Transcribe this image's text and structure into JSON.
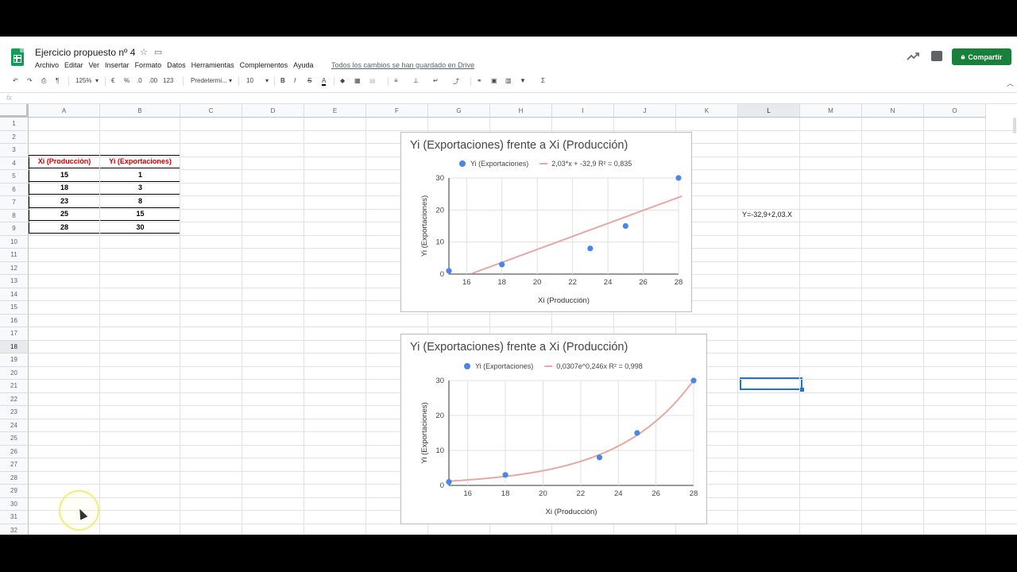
{
  "app": {
    "title": "Ejercicio propuesto nº 4",
    "menu": [
      "Archivo",
      "Editar",
      "Ver",
      "Insertar",
      "Formato",
      "Datos",
      "Herramientas",
      "Complementos",
      "Ayuda"
    ],
    "saved_status": "Todos los cambios se han guardado en Drive",
    "share_label": "Compartir",
    "accent_color": "#188038"
  },
  "toolbar": {
    "zoom": "125%",
    "currency": "€",
    "percent": "%",
    "decimal_less": ".0",
    "decimal_more": ".00",
    "format_more": "123",
    "font": "Predetermi...",
    "font_size": "10",
    "bold": "B",
    "italic": "I",
    "strike": "S",
    "text_color": "A",
    "sum": "Σ"
  },
  "formula_bar": {
    "label": "fx",
    "value": ""
  },
  "grid": {
    "columns": [
      "A",
      "B",
      "C",
      "D",
      "E",
      "F",
      "G",
      "H",
      "I",
      "J",
      "K",
      "L",
      "M",
      "N",
      "O"
    ],
    "selected_column": "L",
    "selected_row": "18",
    "rows": [
      "1",
      "2",
      "3",
      "4",
      "5",
      "6",
      "7",
      "8",
      "9",
      "10",
      "11",
      "12",
      "13",
      "14",
      "15",
      "16",
      "17",
      "18",
      "19",
      "20",
      "21",
      "22",
      "23",
      "24",
      "25",
      "26",
      "27",
      "28",
      "29",
      "30",
      "31",
      "32"
    ],
    "table": {
      "headers": [
        "Xi (Producción)",
        "Yi (Exportaciones)"
      ],
      "rows": [
        [
          "15",
          "1"
        ],
        [
          "18",
          "3"
        ],
        [
          "23",
          "8"
        ],
        [
          "25",
          "15"
        ],
        [
          "28",
          "30"
        ]
      ]
    },
    "note_cell": "Y=-32,9+2,03.X",
    "header_color": "#cc0000"
  },
  "chart_data": [
    {
      "type": "scatter",
      "title": "Yi (Exportaciones) frente a Xi (Producción)",
      "xlabel": "Xi (Producción)",
      "ylabel": "Yi (Exportaciones)",
      "series": [
        {
          "name": "Yi (Exportaciones)",
          "x": [
            15,
            18,
            23,
            25,
            28
          ],
          "y": [
            1,
            3,
            8,
            15,
            30
          ],
          "color": "#4a86e8"
        },
        {
          "name": "2,03*x + -32,9 R² = 0,835",
          "trendline": "linear",
          "slope": 2.03,
          "intercept": -32.9,
          "color": "#e6a8a4"
        }
      ],
      "xticks": [
        16,
        18,
        20,
        22,
        24,
        26,
        28
      ],
      "yticks": [
        0,
        10,
        20,
        30
      ],
      "xlim": [
        15,
        28
      ],
      "ylim": [
        0,
        30
      ],
      "grid": true,
      "legend": "top"
    },
    {
      "type": "scatter",
      "title": "Yi (Exportaciones) frente a Xi (Producción)",
      "xlabel": "Xi (Producción)",
      "ylabel": "Yi (Exportaciones)",
      "series": [
        {
          "name": "Yi (Exportaciones)",
          "x": [
            15,
            18,
            23,
            25,
            28
          ],
          "y": [
            1,
            3,
            8,
            15,
            30
          ],
          "color": "#4a86e8"
        },
        {
          "name": "0,0307e^0,246x R² = 0,998",
          "trendline": "exponential",
          "a": 0.0307,
          "b": 0.246,
          "color": "#e6a8a4"
        }
      ],
      "xticks": [
        16,
        18,
        20,
        22,
        24,
        26,
        28
      ],
      "yticks": [
        0,
        10,
        20,
        30
      ],
      "xlim": [
        15,
        28
      ],
      "ylim": [
        0,
        30
      ],
      "grid": true,
      "legend": "top"
    }
  ]
}
